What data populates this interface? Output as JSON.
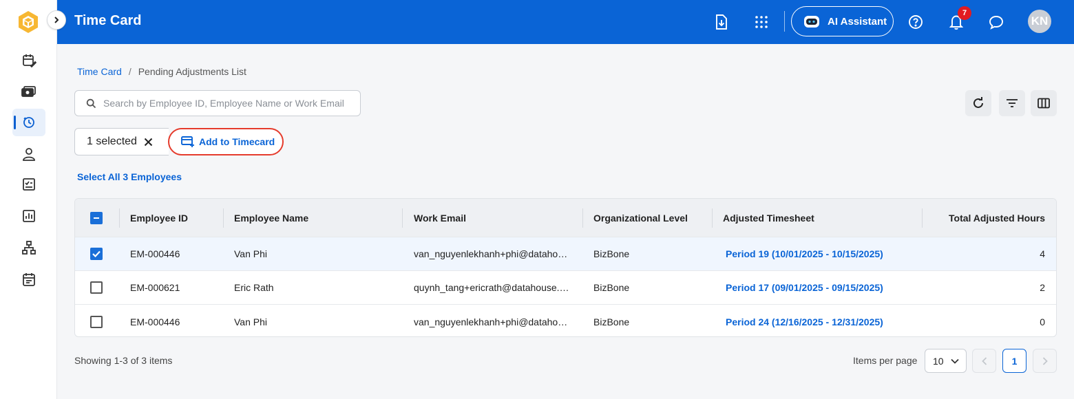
{
  "app": {
    "title": "Time Card"
  },
  "sidebar": {
    "items": [
      {
        "icon": "calendar-edit-icon"
      },
      {
        "icon": "money-icon"
      },
      {
        "icon": "clock-icon",
        "active": true
      },
      {
        "icon": "person-icon"
      },
      {
        "icon": "checklist-icon"
      },
      {
        "icon": "report-chart-icon"
      },
      {
        "icon": "org-chart-icon"
      },
      {
        "icon": "calendar-icon"
      }
    ]
  },
  "header": {
    "ai_assistant_label": "AI Assistant",
    "notification_count": "7",
    "avatar_initials": "KN"
  },
  "breadcrumb": {
    "root": "Time Card",
    "separator": "/",
    "current": "Pending Adjustments List"
  },
  "search": {
    "placeholder": "Search by Employee ID, Employee Name or Work Email",
    "value": ""
  },
  "selection": {
    "selected_label": "1 selected",
    "add_button_label": "Add to Timecard",
    "select_all_label": "Select All 3 Employees"
  },
  "table": {
    "headers": {
      "employee_id": "Employee ID",
      "employee_name": "Employee Name",
      "work_email": "Work Email",
      "org_level": "Organizational Level",
      "adjusted_timesheet": "Adjusted Timesheet",
      "total_hours": "Total Adjusted Hours"
    },
    "rows": [
      {
        "checked": true,
        "employee_id": "EM-000446",
        "employee_name": "Van Phi",
        "work_email": "van_nguyenlekhanh+phi@dataho…",
        "org_level": "BizBone",
        "adjusted_timesheet": "Period 19 (10/01/2025 - 10/15/2025)",
        "total_hours": "4"
      },
      {
        "checked": false,
        "employee_id": "EM-000621",
        "employee_name": "Eric Rath",
        "work_email": "quynh_tang+ericrath@datahouse.…",
        "org_level": "BizBone",
        "adjusted_timesheet": "Period 17 (09/01/2025 - 09/15/2025)",
        "total_hours": "2"
      },
      {
        "checked": false,
        "employee_id": "EM-000446",
        "employee_name": "Van Phi",
        "work_email": "van_nguyenlekhanh+phi@dataho…",
        "org_level": "BizBone",
        "adjusted_timesheet": "Period 24 (12/16/2025 - 12/31/2025)",
        "total_hours": "0"
      }
    ]
  },
  "footer": {
    "showing": "Showing 1-3 of 3 items",
    "items_per_page_label": "Items per page",
    "items_per_page_value": "10",
    "current_page": "1"
  },
  "colors": {
    "primary": "#0a64d6",
    "highlight_outline": "#e53b2c",
    "badge": "#e11b22"
  }
}
